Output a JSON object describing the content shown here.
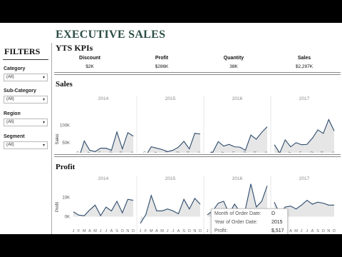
{
  "dashboard_title": "EXECUTIVE SALES",
  "filters": {
    "title": "FILTERS",
    "items": [
      {
        "label": "Category",
        "value": "(All)"
      },
      {
        "label": "Sub-Category",
        "value": "(All)"
      },
      {
        "label": "Region",
        "value": "(All)"
      },
      {
        "label": "Segment",
        "value": "(All)"
      }
    ]
  },
  "kpis": {
    "title": "YTS KPIs",
    "items": [
      {
        "label": "Discount",
        "value": "$2K"
      },
      {
        "label": "Profit",
        "value": "$286K"
      },
      {
        "label": "Quantity",
        "value": "38K"
      },
      {
        "label": "Sales",
        "value": "$2,297K"
      }
    ]
  },
  "sales": {
    "title": "Sales",
    "axis_label": "Sales",
    "ticks": [
      "100K",
      "50K",
      "0K"
    ],
    "month_labels": [
      "Feb",
      "Apr",
      "Jun",
      "Aug",
      "Oct",
      "Dec"
    ]
  },
  "profit": {
    "title": "Profit",
    "axis_label": "Profit",
    "ticks": [
      "10K",
      "0K"
    ],
    "month_letters": [
      "J",
      "F",
      "M",
      "A",
      "M",
      "J",
      "J",
      "A",
      "S",
      "O",
      "N",
      "D"
    ]
  },
  "years": [
    "2014",
    "2015",
    "2016",
    "2017"
  ],
  "chart_data": [
    {
      "type": "area",
      "title": "Sales",
      "ylabel": "Sales",
      "ylim": [
        0,
        120000
      ],
      "x": [
        "Jan",
        "Feb",
        "Mar",
        "Apr",
        "May",
        "Jun",
        "Jul",
        "Aug",
        "Sep",
        "Oct",
        "Nov",
        "Dec"
      ],
      "series": [
        {
          "name": "2014",
          "values": [
            14000,
            5000,
            55000,
            28000,
            24000,
            34000,
            34000,
            28000,
            81000,
            32000,
            79000,
            69000
          ]
        },
        {
          "name": "2015",
          "values": [
            18000,
            12000,
            38000,
            34000,
            30000,
            24000,
            28000,
            37000,
            54000,
            32000,
            77000,
            75000
          ]
        },
        {
          "name": "2016",
          "values": [
            18000,
            22000,
            53000,
            40000,
            45000,
            38000,
            37000,
            28000,
            72000,
            60000,
            80000,
            96000
          ]
        },
        {
          "name": "2017",
          "values": [
            44000,
            20000,
            58000,
            38000,
            50000,
            44000,
            45000,
            63000,
            87000,
            77000,
            117000,
            84000
          ]
        }
      ]
    },
    {
      "type": "area",
      "title": "Profit",
      "ylabel": "Profit",
      "ylim": [
        -5000,
        15000
      ],
      "x": [
        "Jan",
        "Feb",
        "Mar",
        "Apr",
        "May",
        "Jun",
        "Jul",
        "Aug",
        "Sep",
        "Oct",
        "Nov",
        "Dec"
      ],
      "series": [
        {
          "name": "2014",
          "values": [
            2500,
            800,
            500,
            3500,
            6000,
            500,
            5000,
            3000,
            8000,
            2000,
            9000,
            8500
          ]
        },
        {
          "name": "2015",
          "values": [
            -3500,
            1000,
            11000,
            3000,
            3000,
            4000,
            3000,
            1500,
            9000,
            4000,
            9500,
            6500
          ]
        },
        {
          "name": "2016",
          "values": [
            1000,
            3000,
            7000,
            8000,
            1500,
            6500,
            2500,
            4000,
            17000,
            5000,
            8000,
            16000
          ]
        },
        {
          "name": "2017",
          "values": [
            7500,
            1500,
            5000,
            5500,
            4000,
            6000,
            8500,
            6500,
            7500,
            7000,
            6000,
            6000
          ]
        }
      ]
    }
  ],
  "tooltip": {
    "rows": [
      {
        "label": "Month of Order Date:",
        "value": "D"
      },
      {
        "label": "Year of Order Date:",
        "value": "2015"
      },
      {
        "label": "Profit:",
        "value": "$,517"
      }
    ]
  }
}
